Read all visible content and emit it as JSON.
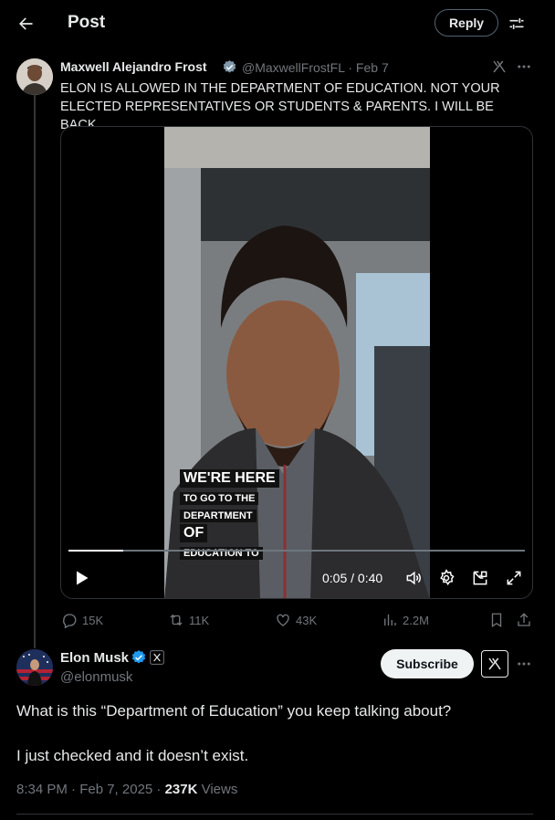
{
  "header": {
    "title": "Post",
    "reply_label": "Reply"
  },
  "quoted": {
    "name": "Maxwell Alejandro Frost",
    "handle_date": "@MaxwellFrostFL · Feb 7",
    "text": "ELON IS ALLOWED IN THE DEPARTMENT OF EDUCATION. NOT YOUR ELECTED REPRESENTATIVES OR STUDENTS & PARENTS. I WILL BE BACK.",
    "video": {
      "caption": [
        "WE'RE HERE",
        "TO GO TO THE",
        "DEPARTMENT",
        "OF",
        "EDUCATION TO"
      ],
      "time": "0:05 / 0:40",
      "progress_percent": 12
    },
    "stats": {
      "replies": "15K",
      "reposts": "11K",
      "likes": "43K",
      "views": "2.2M"
    }
  },
  "main": {
    "name": "Elon Musk",
    "handle": "@elonmusk",
    "subscribe_label": "Subscribe",
    "text_line1": "What is this “Department of Education” you keep talking about?",
    "text_line2": "I just checked and it doesn’t exist.",
    "time_date": "8:34 PM · Feb 7, 2025 · ",
    "views_count": "237K",
    "views_label": " Views"
  },
  "colors": {
    "background": "#000000",
    "verified": "#1d9bf0",
    "muted": "#71767b",
    "text": "#e7e9ea"
  },
  "icons": [
    "back-arrow-icon",
    "settings-sliders-icon",
    "verified-badge-icon",
    "grok-icon",
    "more-icon",
    "play-icon",
    "volume-icon",
    "gear-icon",
    "pip-icon",
    "fullscreen-icon",
    "reply-icon",
    "repost-icon",
    "like-icon",
    "views-icon",
    "bookmark-icon",
    "share-icon",
    "x-logo-icon"
  ]
}
